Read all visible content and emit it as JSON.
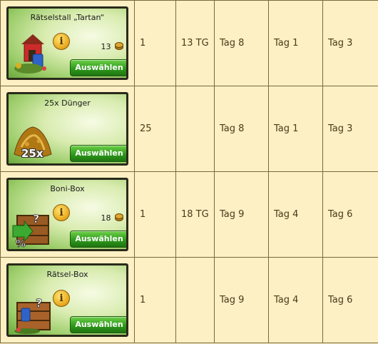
{
  "rows": [
    {
      "card": {
        "title": "Rätselstall „Tartan“",
        "price": "13",
        "button": "Auswählen",
        "art": "tartan-stable-icon"
      },
      "cells": [
        "1",
        "13 TG",
        "Tag 8",
        "Tag 1",
        "Tag 3"
      ]
    },
    {
      "card": {
        "title": "25x Dünger",
        "overlay": "25x",
        "button": "Auswählen",
        "art": "fertilizer-icon"
      },
      "cells": [
        "25",
        "",
        "Tag 8",
        "Tag 1",
        "Tag 3"
      ]
    },
    {
      "card": {
        "title": "Boni-Box",
        "price": "18",
        "button": "Auswählen",
        "art": "bonus-box-icon"
      },
      "cells": [
        "1",
        "18 TG",
        "Tag 9",
        "Tag 4",
        "Tag 6"
      ]
    },
    {
      "card": {
        "title": "Rätsel-Box",
        "button": "Auswählen",
        "art": "puzzle-box-icon"
      },
      "cells": [
        "1",
        "",
        "Tag 9",
        "Tag 4",
        "Tag 6"
      ]
    }
  ],
  "colors": {
    "background": "#fdf0c4",
    "button_green": "#2f9a1c",
    "info_gold": "#e7a51a"
  }
}
